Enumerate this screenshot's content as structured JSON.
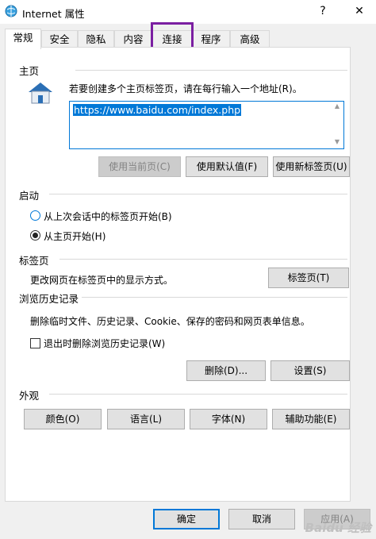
{
  "window": {
    "title": "Internet 属性",
    "help_glyph": "?",
    "close_glyph": "✕"
  },
  "tabs": [
    {
      "label": "常规"
    },
    {
      "label": "安全"
    },
    {
      "label": "隐私"
    },
    {
      "label": "内容"
    },
    {
      "label": "连接"
    },
    {
      "label": "程序"
    },
    {
      "label": "高级"
    }
  ],
  "homepage": {
    "section": "主页",
    "instruction": "若要创建多个主页标签页，请在每行输入一个地址(R)。",
    "url": "https://www.baidu.com/index.php",
    "btn_current": "使用当前页(C)",
    "btn_default": "使用默认值(F)",
    "btn_newtab": "使用新标签页(U)"
  },
  "startup": {
    "section": "启动",
    "option_last": "从上次会话中的标签页开始(B)",
    "option_home": "从主页开始(H)"
  },
  "tabs_section": {
    "section": "标签页",
    "desc": "更改网页在标签页中的显示方式。",
    "btn": "标签页(T)"
  },
  "history": {
    "section": "浏览历史记录",
    "desc": "删除临时文件、历史记录、Cookie、保存的密码和网页表单信息。",
    "checkbox": "退出时删除浏览历史记录(W)",
    "btn_delete": "删除(D)...",
    "btn_settings": "设置(S)"
  },
  "appearance": {
    "section": "外观",
    "btn_colors": "颜色(O)",
    "btn_languages": "语言(L)",
    "btn_fonts": "字体(N)",
    "btn_accessibility": "辅助功能(E)"
  },
  "footer": {
    "ok": "确定",
    "cancel": "取消",
    "apply": "应用(A)"
  },
  "watermark": "Baidu 经验",
  "colors": {
    "accent": "#0078d7",
    "annotation": "#7b1fa2"
  }
}
